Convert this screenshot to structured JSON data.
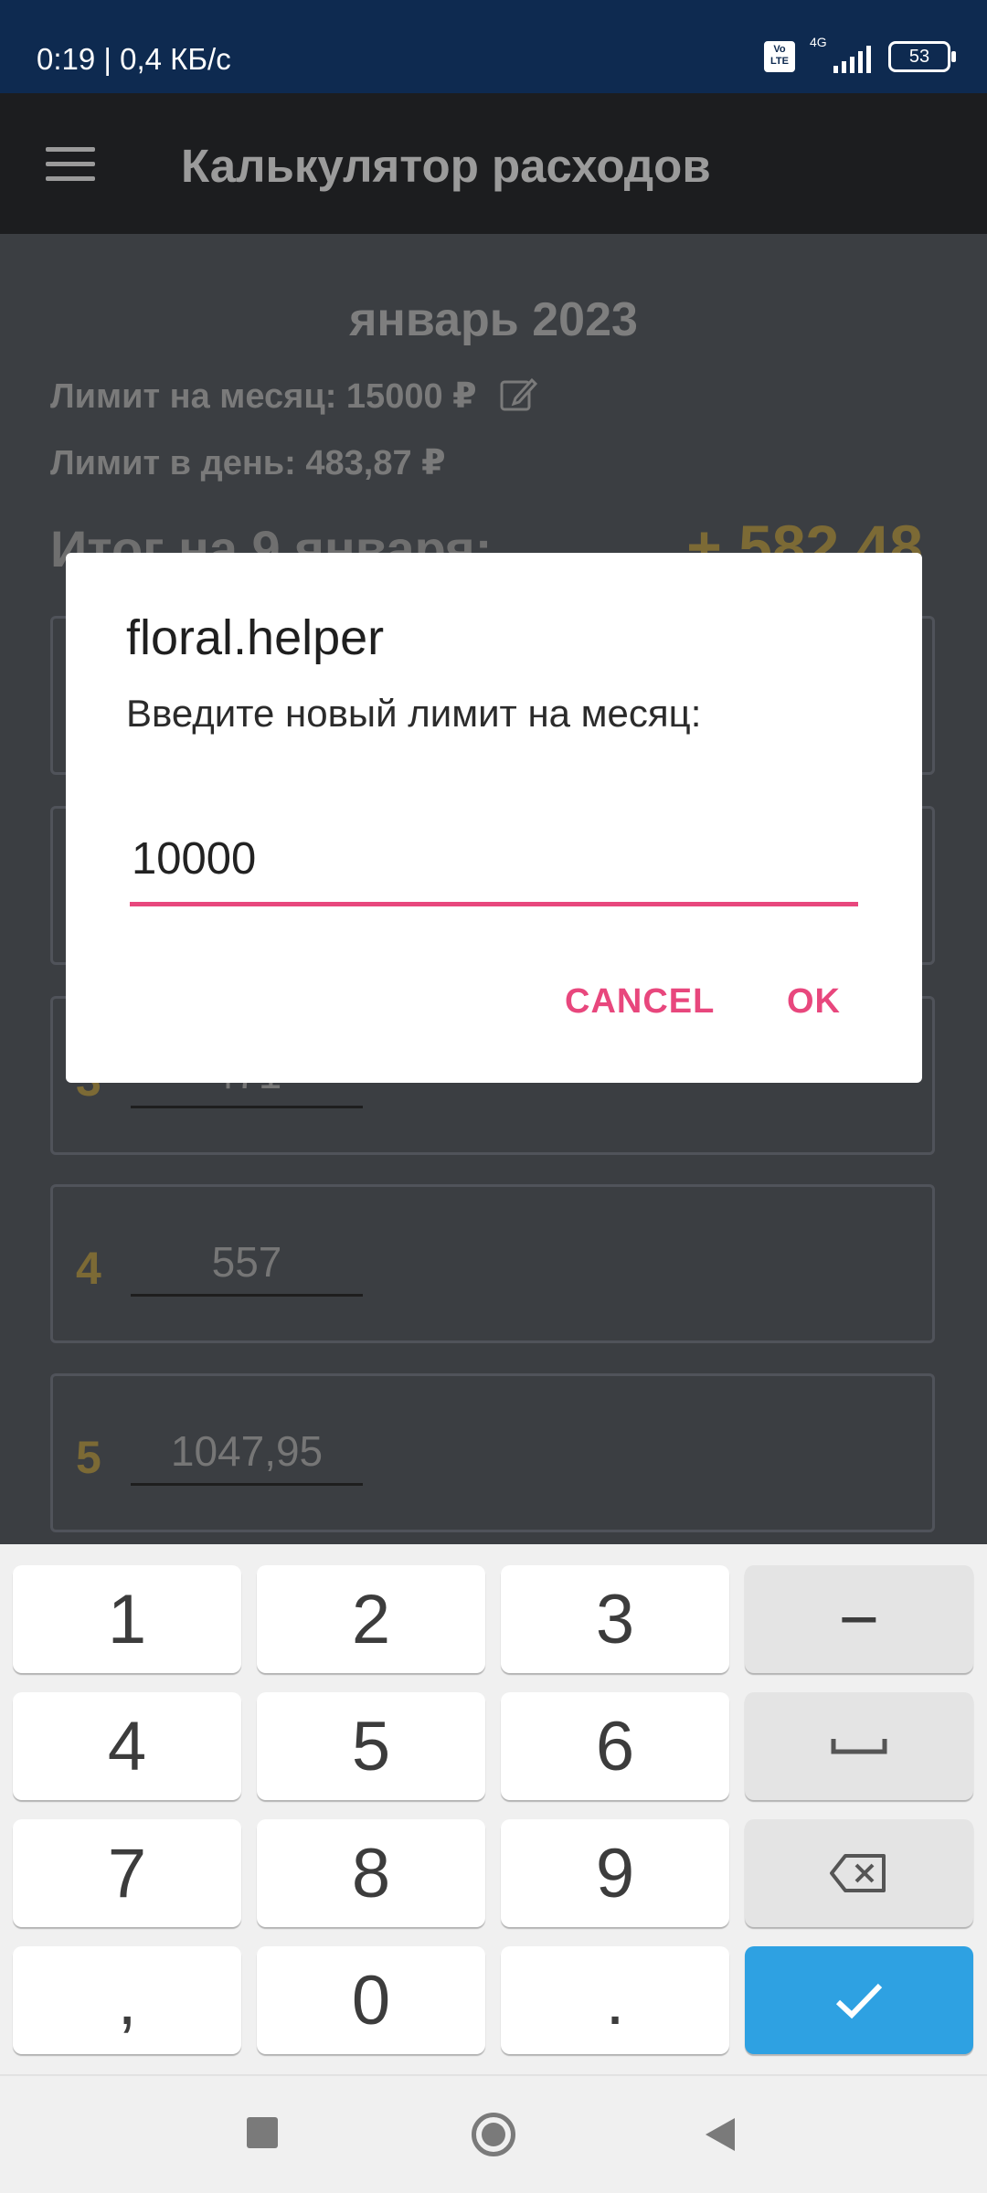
{
  "status_bar": {
    "time": "0:19 | 0,4 КБ/с",
    "volte": "Vo LTE",
    "network": "4G",
    "battery": "53"
  },
  "app_bar": {
    "title": "Калькулятор расходов"
  },
  "summary": {
    "month": "январь 2023",
    "limit_month": "Лимит на месяц: 15000 ₽",
    "limit_day": "Лимит в день: 483,87 ₽",
    "total_label": "Итог на 9 января:",
    "total_value": "+ 582,48"
  },
  "days": [
    {
      "num": "3",
      "value": "471"
    },
    {
      "num": "4",
      "value": "557"
    },
    {
      "num": "5",
      "value": "1047,95"
    }
  ],
  "dialog": {
    "title": "floral.helper",
    "message": "Введите новый лимит на месяц:",
    "input_value": "10000",
    "cancel_label": "CANCEL",
    "ok_label": "OK"
  },
  "keyboard": {
    "keys": [
      "1",
      "2",
      "3",
      "−",
      "4",
      "5",
      "6",
      "␣",
      "7",
      "8",
      "9",
      "⌫",
      ",",
      "0",
      ".",
      "✓"
    ]
  },
  "colors": {
    "accent": "#e8477d",
    "status_bar": "#0e2a50",
    "enter_key": "#2ea1e2",
    "gold": "#7c6a35"
  }
}
